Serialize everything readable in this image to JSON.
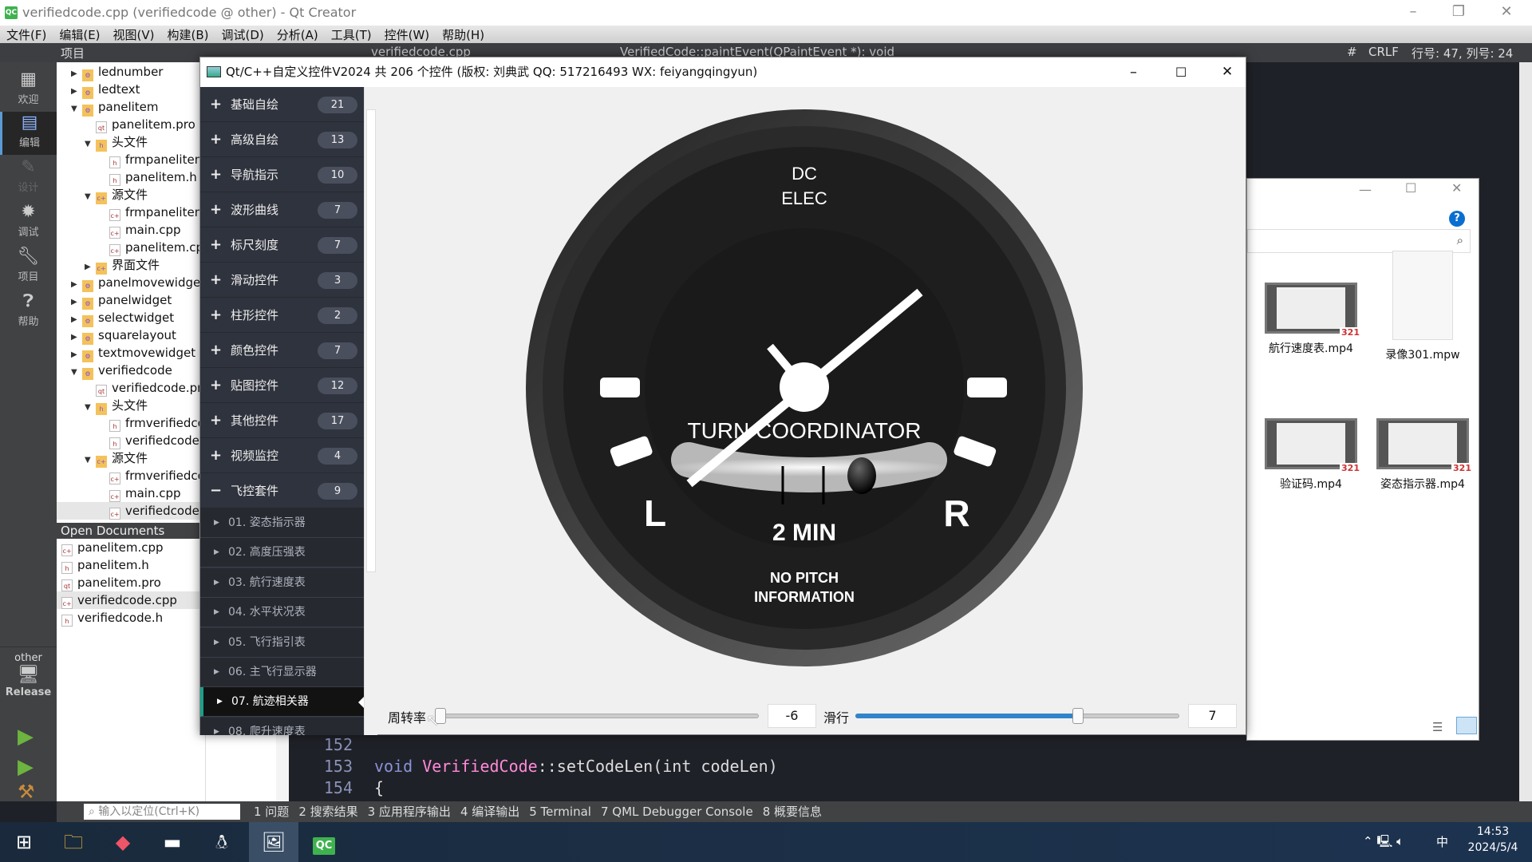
{
  "window": {
    "title": "verifiedcode.cpp (verifiedcode @ other) - Qt Creator",
    "app_icon": "QC"
  },
  "menu": [
    "文件(F)",
    "编辑(E)",
    "视图(V)",
    "构建(B)",
    "调试(D)",
    "分析(A)",
    "工具(T)",
    "控件(W)",
    "帮助(H)"
  ],
  "toolbar": {
    "projects_label": "项目",
    "file_tab": "verifiedcode.cpp",
    "symbol": "VerifiedCode::paintEvent(QPaintEvent *): void",
    "hash": "#",
    "line_ending": "CRLF",
    "position": "行号: 47, 列号: 24"
  },
  "modes": [
    {
      "label": "欢迎",
      "icon": "grid-icon"
    },
    {
      "label": "编辑",
      "icon": "edit-icon"
    },
    {
      "label": "设计",
      "icon": "pencil-icon"
    },
    {
      "label": "调试",
      "icon": "bug-icon"
    },
    {
      "label": "项目",
      "icon": "wrench-icon"
    },
    {
      "label": "帮助",
      "icon": "help-icon"
    }
  ],
  "kit": {
    "project": "other",
    "build": "Release"
  },
  "tree": [
    {
      "label": "lednumber",
      "level": 0,
      "arrow": "▶",
      "type": "project"
    },
    {
      "label": "ledtext",
      "level": 0,
      "arrow": "▶",
      "type": "project"
    },
    {
      "label": "panelitem",
      "level": 0,
      "arrow": "▼",
      "type": "project"
    },
    {
      "label": "panelitem.pro",
      "level": 1,
      "arrow": "",
      "type": "pro"
    },
    {
      "label": "头文件",
      "level": 1,
      "arrow": "▼",
      "type": "folder-h"
    },
    {
      "label": "frmpanelitem.h",
      "level": 2,
      "arrow": "",
      "type": "h"
    },
    {
      "label": "panelitem.h",
      "level": 2,
      "arrow": "",
      "type": "h"
    },
    {
      "label": "源文件",
      "level": 1,
      "arrow": "▼",
      "type": "folder-cpp"
    },
    {
      "label": "frmpanelitem.cpp",
      "level": 2,
      "arrow": "",
      "type": "cpp"
    },
    {
      "label": "main.cpp",
      "level": 2,
      "arrow": "",
      "type": "cpp"
    },
    {
      "label": "panelitem.cpp",
      "level": 2,
      "arrow": "",
      "type": "cpp"
    },
    {
      "label": "界面文件",
      "level": 1,
      "arrow": "▶",
      "type": "folder-ui"
    },
    {
      "label": "panelmovewidget",
      "level": 0,
      "arrow": "▶",
      "type": "project"
    },
    {
      "label": "panelwidget",
      "level": 0,
      "arrow": "▶",
      "type": "project"
    },
    {
      "label": "selectwidget",
      "level": 0,
      "arrow": "▶",
      "type": "project"
    },
    {
      "label": "squarelayout",
      "level": 0,
      "arrow": "▶",
      "type": "project"
    },
    {
      "label": "textmovewidget",
      "level": 0,
      "arrow": "▶",
      "type": "project"
    },
    {
      "label": "verifiedcode",
      "level": 0,
      "arrow": "▼",
      "type": "project"
    },
    {
      "label": "verifiedcode.pro",
      "level": 1,
      "arrow": "",
      "type": "pro"
    },
    {
      "label": "头文件",
      "level": 1,
      "arrow": "▼",
      "type": "folder-h"
    },
    {
      "label": "frmverifiedcode.h",
      "level": 2,
      "arrow": "",
      "type": "h"
    },
    {
      "label": "verifiedcode.h",
      "level": 2,
      "arrow": "",
      "type": "h"
    },
    {
      "label": "源文件",
      "level": 1,
      "arrow": "▼",
      "type": "folder-cpp"
    },
    {
      "label": "frmverifiedcode.cpp",
      "level": 2,
      "arrow": "",
      "type": "cpp"
    },
    {
      "label": "main.cpp",
      "level": 2,
      "arrow": "",
      "type": "cpp"
    },
    {
      "label": "verifiedcode.cpp",
      "level": 2,
      "arrow": "",
      "type": "cpp",
      "selected": true
    }
  ],
  "open_documents": {
    "title": "Open Documents",
    "items": [
      {
        "label": "panelitem.cpp",
        "type": "cpp"
      },
      {
        "label": "panelitem.h",
        "type": "h"
      },
      {
        "label": "panelitem.pro",
        "type": "pro"
      },
      {
        "label": "verifiedcode.cpp",
        "type": "cpp",
        "selected": true
      },
      {
        "label": "verifiedcode.h",
        "type": "h"
      }
    ]
  },
  "editor": {
    "line_numbers": [
      "152",
      "153",
      "154"
    ],
    "lines": [
      {
        "kw": "",
        "cls": "",
        "rest": ""
      },
      {
        "kw": "void ",
        "cls": "VerifiedCode",
        "rest": "::setCodeLen(int codeLen)"
      },
      {
        "kw": "",
        "cls": "",
        "rest": "{"
      }
    ]
  },
  "output_bar": {
    "search_placeholder": "输入以定位(Ctrl+K)",
    "tabs": [
      "1 问题",
      "2 搜索结果",
      "3 应用程序输出",
      "4 编译输出",
      "5 Terminal",
      "7 QML Debugger Console",
      "8 概要信息"
    ]
  },
  "popup": {
    "title": "Qt/C++自定义控件V2024 共 206 个控件 (版权: 刘典武 QQ: 517216493 WX: feiyangqingyun)",
    "categories": [
      {
        "label": "基础自绘",
        "count": "21",
        "sign": "+"
      },
      {
        "label": "高级自绘",
        "count": "13",
        "sign": "+"
      },
      {
        "label": "导航指示",
        "count": "10",
        "sign": "+"
      },
      {
        "label": "波形曲线",
        "count": "7",
        "sign": "+"
      },
      {
        "label": "标尺刻度",
        "count": "7",
        "sign": "+"
      },
      {
        "label": "滑动控件",
        "count": "3",
        "sign": "+"
      },
      {
        "label": "柱形控件",
        "count": "2",
        "sign": "+"
      },
      {
        "label": "颜色控件",
        "count": "7",
        "sign": "+"
      },
      {
        "label": "贴图控件",
        "count": "12",
        "sign": "+"
      },
      {
        "label": "其他控件",
        "count": "17",
        "sign": "+"
      },
      {
        "label": "视频监控",
        "count": "4",
        "sign": "+"
      },
      {
        "label": "飞控套件",
        "count": "9",
        "sign": "−"
      }
    ],
    "subitems": [
      "01. 姿态指示器",
      "02. 高度压强表",
      "03. 航行速度表",
      "04. 水平状况表",
      "05. 飞行指引表",
      "06. 主飞行显示器",
      "07. 航迹相关器",
      "08. 爬升速度表"
    ],
    "active_subitem": "07. 航迹相关器",
    "gauge": {
      "top_line1": "DC",
      "top_line2": "ELEC",
      "title": "TURN COORDINATOR",
      "left": "L",
      "right": "R",
      "rate": "2 MIN",
      "bottom_line1": "NO PITCH",
      "bottom_line2": "INFORMATION"
    },
    "controls": {
      "turn_rate_label": "周转率",
      "turn_rate_value": "-6",
      "turn_rate_min": -10,
      "turn_rate_max": 10,
      "slip_label": "滑行",
      "slip_value": "7",
      "slip_min": -10,
      "slip_max": 10,
      "accent": "#2f84cc"
    }
  },
  "explorer": {
    "files": [
      {
        "name": "航行速度表.mp4",
        "type": "video"
      },
      {
        "name": "录像301.mpw",
        "type": "file"
      },
      {
        "name": "验证码.mp4",
        "type": "video"
      },
      {
        "name": "姿态指示器.mp4",
        "type": "video"
      }
    ],
    "badge": "321"
  },
  "taskbar": {
    "time": "14:53",
    "date": "2024/5/4",
    "ime": "中",
    "apps": [
      "windows-start-icon",
      "file-explorer-icon",
      "git-icon",
      "terminal-icon",
      "qq-icon",
      "image-viewer-icon",
      "qt-creator-icon"
    ]
  }
}
